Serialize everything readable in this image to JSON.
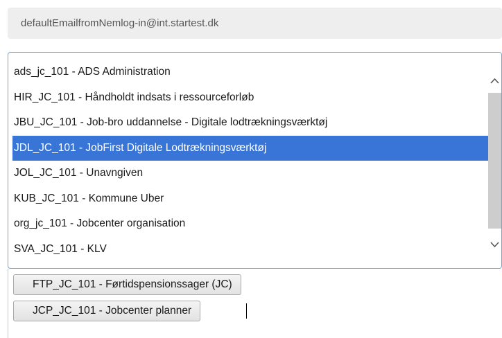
{
  "email": {
    "value": "defaultEmailfromNemlog-in@int.startest.dk"
  },
  "list": {
    "items": [
      {
        "label": "ads_jc_101 - ADS Administration",
        "selected": false
      },
      {
        "label": "HIR_JC_101 - Håndholdt indsats i ressourceforløb",
        "selected": false
      },
      {
        "label": "JBU_JC_101 - Job-bro uddannelse - Digitale lodtrækningsværktøj",
        "selected": false
      },
      {
        "label": "JDL_JC_101 - JobFirst Digitale Lodtrækningsværktøj",
        "selected": true
      },
      {
        "label": "JOL_JC_101 - Unavngiven",
        "selected": false
      },
      {
        "label": "KUB_JC_101 - Kommune Uber",
        "selected": false
      },
      {
        "label": "org_jc_101 - Jobcenter organisation",
        "selected": false
      },
      {
        "label": "SVA_JC_101 - KLV",
        "selected": false
      }
    ],
    "scroll_up_icon": "chevron-up-icon",
    "scroll_down_icon": "chevron-down-icon"
  },
  "chips": [
    {
      "label": "FTP_JC_101 - Førtidspensionssager (JC)"
    },
    {
      "label": "JCP_JC_101 - Jobcenter planner"
    }
  ],
  "colors": {
    "selection": "#3875d7",
    "focus_border": "#6fa3e0",
    "field_background": "#eeeeee"
  }
}
